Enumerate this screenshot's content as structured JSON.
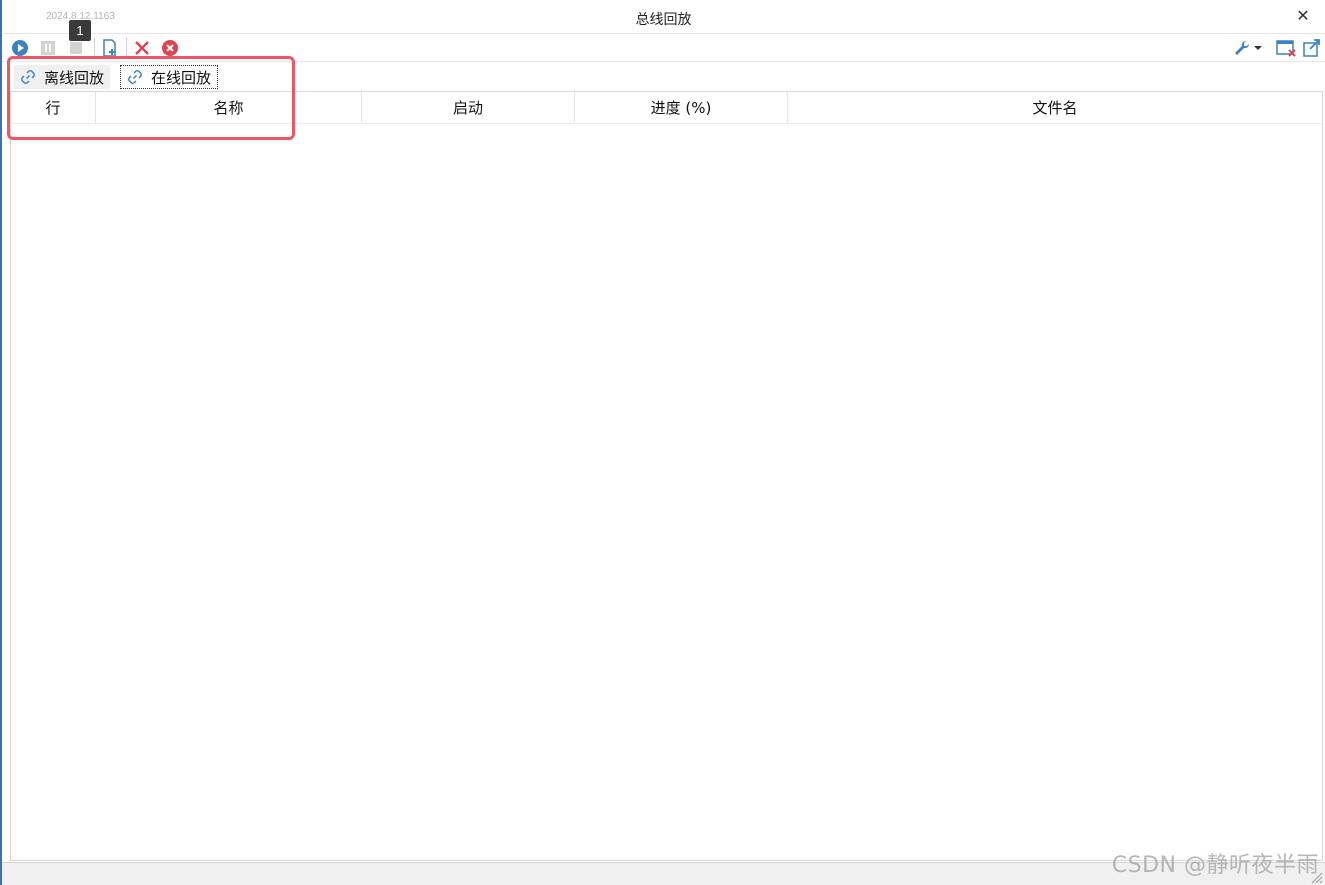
{
  "window": {
    "version": "2024.8.12.1163",
    "title": "总线回放",
    "close_glyph": "✕"
  },
  "toolbar": {
    "badge": "1",
    "icons": [
      "play-icon",
      "pause-icon",
      "stop-icon",
      "add-file-icon",
      "delete-icon",
      "clear-all-icon",
      "wrench-icon",
      "chevron-down-icon",
      "window-close-icon",
      "export-icon"
    ]
  },
  "tabs": [
    {
      "label": "离线回放",
      "icon": "link-icon"
    },
    {
      "label": "在线回放",
      "icon": "link-icon"
    }
  ],
  "grid": {
    "columns": [
      "行",
      "名称",
      "启动",
      "进度 (%)",
      "文件名"
    ],
    "rows": []
  },
  "watermark": "CSDN @静听夜半雨",
  "colors": {
    "accent_blue": "#3b82c4",
    "danger_red": "#e0424f",
    "highlight": "#ee5566"
  }
}
